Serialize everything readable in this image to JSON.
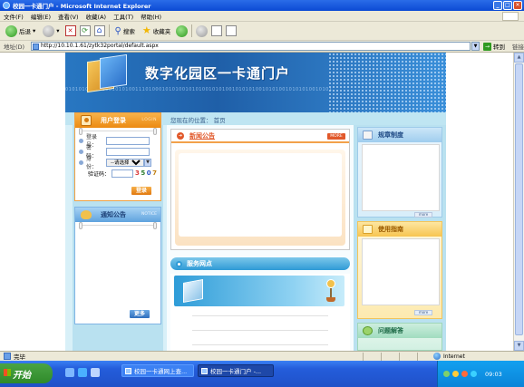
{
  "window": {
    "title": "校园一卡通门户 - Microsoft Internet Explorer"
  },
  "menu": {
    "items": [
      "文件(F)",
      "编辑(E)",
      "查看(V)",
      "收藏(A)",
      "工具(T)",
      "帮助(H)"
    ]
  },
  "toolbar": {
    "back": "后退",
    "search": "搜索",
    "favorites": "收藏夹"
  },
  "address": {
    "label": "地址(D)",
    "url": "http://10.10.1.61/zytk32portal/default.aspx",
    "go": "转到",
    "links": "链接"
  },
  "portal": {
    "banner_title": "数字化园区一卡通门户",
    "banner_binary": "01010100110100101010011101000101010010101001010100101010100101010010101010010101",
    "breadcrumb": "您现在的位置：  首页",
    "login": {
      "title": "用户登录",
      "title_en": "LOGIN",
      "username_label": "登录号：",
      "username_value": "",
      "password_label": "密　码：",
      "identity_label": "身　份：",
      "identity_selected": "--请选择--",
      "captcha_label": "验证码：",
      "captcha_value": "",
      "captcha_code": [
        "3",
        "5",
        "0",
        "7"
      ],
      "submit": "登录"
    },
    "notice": {
      "title": "通知公告",
      "title_en": "NOTICE",
      "more": "更多"
    },
    "news": {
      "title": "新闻公告",
      "more": "MORE"
    },
    "service": {
      "title": "服务网点"
    },
    "rules": {
      "title": "规章制度",
      "more": "more"
    },
    "guide": {
      "title": "使用指南",
      "more": "more"
    },
    "faq": {
      "title": "问题解答"
    }
  },
  "status": {
    "text": "完毕",
    "zone": "Internet"
  },
  "taskbar": {
    "start": "开始",
    "tasks": [
      "校园一卡通网上查...",
      "校园一卡通门户 -..."
    ],
    "clock": "09:03"
  },
  "colors": {
    "banner": "#2877c2",
    "login_orange": "#ec8a12",
    "news_red": "#e1582a",
    "service_blue": "#2f9ad6"
  }
}
